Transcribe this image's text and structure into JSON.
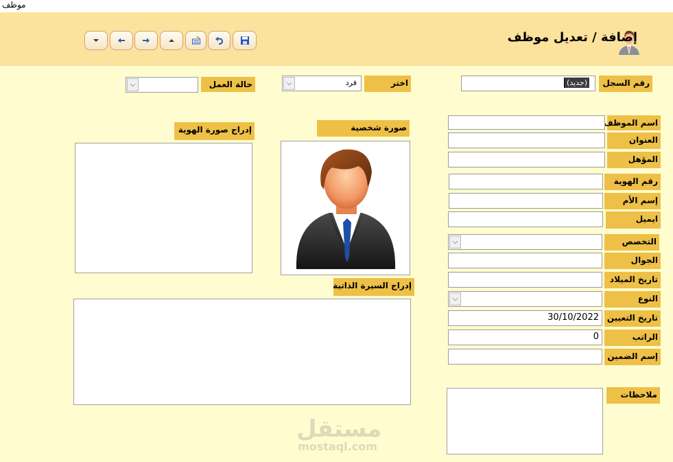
{
  "window": {
    "title": "موظف"
  },
  "header": {
    "title": "إضافة / تعديل موظف"
  },
  "toolbar": {
    "buttons": [
      "save-icon",
      "undo-icon",
      "edit-icon",
      "first-record-icon",
      "next-icon",
      "previous-icon",
      "last-record-icon"
    ]
  },
  "top_fields": {
    "record_no": {
      "label": "رقم السجل",
      "value": "(جديد)"
    },
    "choose": {
      "label": "اختر",
      "value": "فرد"
    },
    "work_status": {
      "label": "حالة العمل",
      "value": ""
    }
  },
  "fields": {
    "employee_name": {
      "label": "اسم الموظف",
      "value": ""
    },
    "address": {
      "label": "العنوان",
      "value": ""
    },
    "qualification": {
      "label": "المؤهل",
      "value": ""
    },
    "id_number": {
      "label": "رقم الهوية",
      "value": ""
    },
    "mother_name": {
      "label": "إسم الأم",
      "value": ""
    },
    "email": {
      "label": "ايميل",
      "value": ""
    },
    "specialization": {
      "label": "التخصص",
      "value": ""
    },
    "mobile": {
      "label": "الجوال",
      "value": ""
    },
    "birth_date": {
      "label": "تاريخ الميلاد",
      "value": ""
    },
    "gender": {
      "label": "النوع",
      "value": ""
    },
    "hire_date": {
      "label": "تاريخ التعيين",
      "value": "30/10/2022"
    },
    "salary": {
      "label": "الراتب",
      "value": "0"
    },
    "guarantor_name": {
      "label": "إسم الضمين",
      "value": ""
    },
    "notes": {
      "label": "ملاحظات",
      "value": ""
    }
  },
  "media": {
    "photo_label": "صورة شخصية",
    "id_image_label": "إدراج صورة الهوية",
    "cv_label": "إدراج السيرة الذاتية"
  },
  "watermark": {
    "arabic": "مستقل",
    "latin": "mostaql.com"
  },
  "colors": {
    "background": "#FFFDD0",
    "header": "#FBE29D",
    "label": "#EEC047",
    "button_border": "#E19B72"
  }
}
